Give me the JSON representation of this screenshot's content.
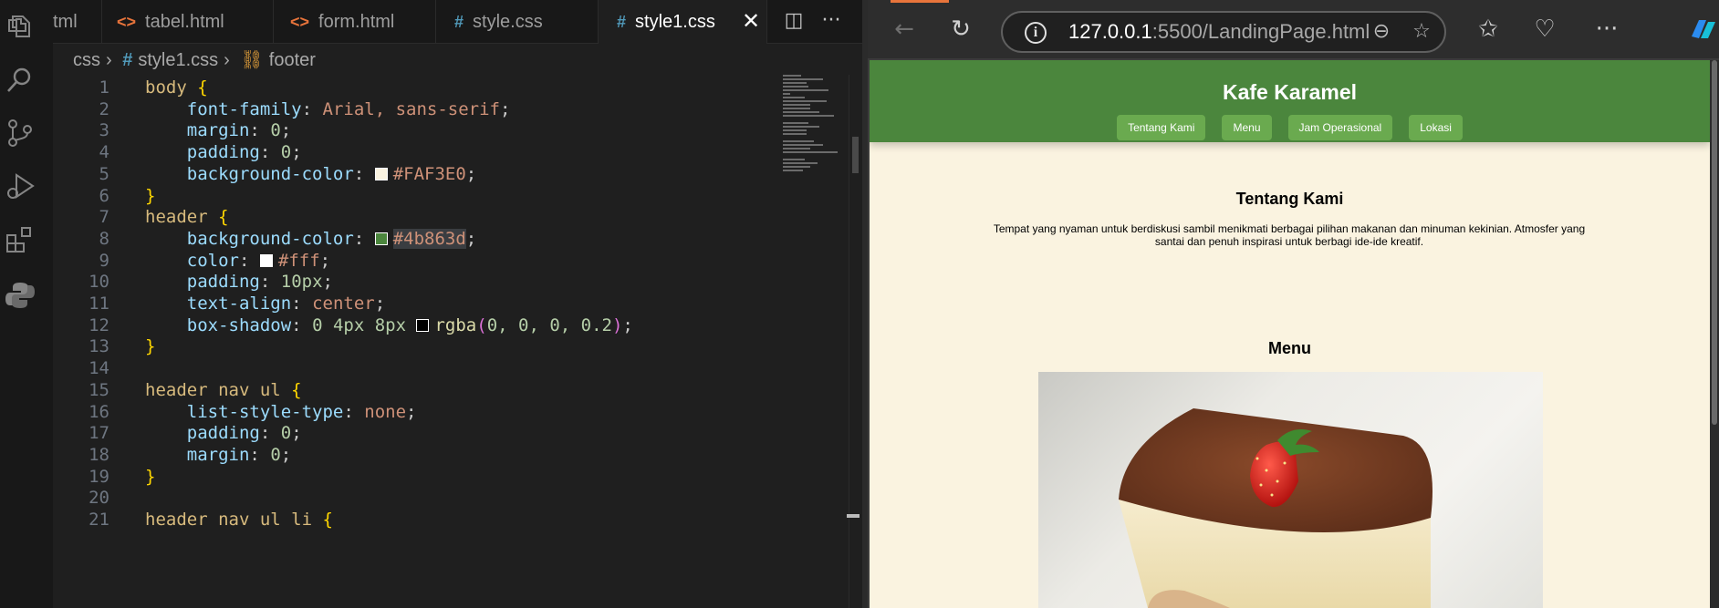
{
  "editor": {
    "tabs": [
      {
        "label": "tml",
        "icon": "none"
      },
      {
        "label": "tabel.html",
        "icon": "html"
      },
      {
        "label": "form.html",
        "icon": "html"
      },
      {
        "label": "style.css",
        "icon": "css"
      },
      {
        "label": "style1.css",
        "icon": "css",
        "active": true
      }
    ],
    "file_icons": {
      "html": "<>",
      "css": "#"
    },
    "breadcrumb": {
      "folder": "css",
      "file": "style1.css",
      "symbol": "footer"
    },
    "line_numbers": [
      "1",
      "2",
      "3",
      "4",
      "5",
      "6",
      "7",
      "8",
      "9",
      "10",
      "11",
      "12",
      "13",
      "14",
      "15",
      "16",
      "17",
      "18",
      "19",
      "20",
      "21"
    ],
    "code": {
      "l1_sel": "body",
      "l1_brace": "{",
      "l2_prop": "font-family",
      "l2_val": "Arial, sans-serif",
      "l2_end": ";",
      "l3_prop": "margin",
      "l3_val": "0",
      "l3_end": ";",
      "l4_prop": "padding",
      "l4_val": "0",
      "l4_end": ";",
      "l5_prop": "background-color",
      "l5_val": "#FAF3E0",
      "l5_end": ";",
      "l6_brace": "}",
      "l7_sel": "header",
      "l7_brace": "{",
      "l8_prop": "background-color",
      "l8_val": "#4b863d",
      "l8_end": ";",
      "l9_prop": "color",
      "l9_val": "#fff",
      "l9_end": ";",
      "l10_prop": "padding",
      "l10_val": "10px",
      "l10_end": ";",
      "l11_prop": "text-align",
      "l11_val": "center",
      "l11_end": ";",
      "l12_prop": "box-shadow",
      "l12_nums": "0 4px 8px",
      "l12_fn": "rgba",
      "l12_open": "(",
      "l12_args": "0, 0, 0, 0.2",
      "l12_close": ")",
      "l12_end": ";",
      "l13_brace": "}",
      "l15_sel": "header nav ul",
      "l15_brace": "{",
      "l16_prop": "list-style-type",
      "l16_val": "none",
      "l16_end": ";",
      "l17_prop": "padding",
      "l17_val": "0",
      "l17_end": ";",
      "l18_prop": "margin",
      "l18_val": "0",
      "l18_end": ";",
      "l19_brace": "}",
      "l21_sel": "header nav ul li",
      "l21_brace": "{"
    },
    "colon": ":",
    "swatches": {
      "bg": "#FAF3E0",
      "header": "#4b863d",
      "text": "#fff",
      "shadow": "#000000"
    },
    "close_glyph": "✕",
    "split_glyph": "◫",
    "more_glyph": "···"
  },
  "browser": {
    "back_glyph": "←",
    "reload_glyph": "↻",
    "url_host": "127.0.0.1",
    "url_rest": ":5500/LandingPage.html",
    "info_glyph": "i",
    "zoom_glyph": "⊖",
    "star_glyph": "☆",
    "favorites_glyph": "✩",
    "health_glyph": "♡",
    "more_glyph": "···"
  },
  "site": {
    "title": "Kafe Karamel",
    "nav": [
      "Tentang Kami",
      "Menu",
      "Jam Operasional",
      "Lokasi"
    ],
    "about_heading": "Tentang Kami",
    "about_text": "Tempat yang nyaman untuk berdiskusi sambil menikmati berbagai pilihan makanan dan minuman kekinian. Atmosfer yang santai dan penuh inspirasi untuk berbagi ide-ide kreatif.",
    "menu_heading": "Menu"
  }
}
